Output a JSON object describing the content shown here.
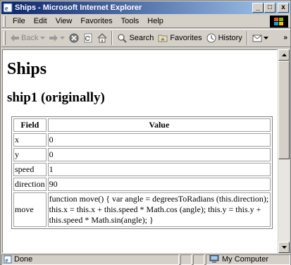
{
  "window": {
    "title": "Ships - Microsoft Internet Explorer",
    "minimize": "_",
    "maximize": "□",
    "close": "x"
  },
  "menu": [
    "File",
    "Edit",
    "View",
    "Favorites",
    "Tools",
    "Help"
  ],
  "toolbar": {
    "back": "Back",
    "search": "Search",
    "favorites": "Favorites",
    "history": "History",
    "more": "»"
  },
  "page": {
    "title": "Ships",
    "subtitle": "ship1 (originally)",
    "table": {
      "headers": [
        "Field",
        "Value"
      ],
      "rows": [
        {
          "field": "x",
          "value": "0"
        },
        {
          "field": "y",
          "value": "0"
        },
        {
          "field": "speed",
          "value": "1"
        },
        {
          "field": "direction",
          "value": "90"
        },
        {
          "field": "move",
          "value": "function move() { var angle = degreesToRadians (this.direction); this.x = this.x + this.speed * Math.cos (angle); this.y = this.y + this.speed * Math.sin(angle); }"
        }
      ]
    }
  },
  "status": {
    "text": "Done",
    "zone": "My Computer"
  },
  "colors": {
    "titlebar_start": "#0a246a",
    "titlebar_end": "#a6caf0",
    "chrome": "#d4d0c8"
  }
}
